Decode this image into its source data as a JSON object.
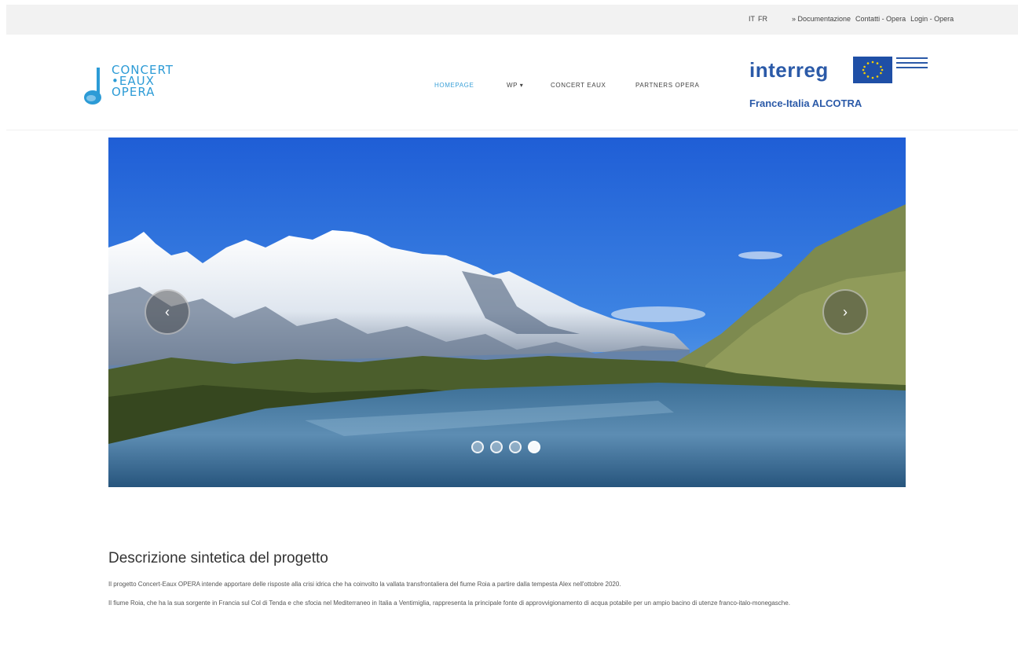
{
  "topbar": {
    "lang_it": "IT",
    "lang_fr": "FR",
    "links": [
      "» Documentazione",
      "Contatti - Opera",
      "Login - Opera"
    ]
  },
  "logo": {
    "line1": "CONCERT",
    "line2": "EAUX",
    "line3": "OPERA"
  },
  "nav": {
    "items": [
      "HOMEPAGE",
      "WP ▾",
      "CONCERT EAUX",
      "PARTNERS OPERA"
    ]
  },
  "interreg": {
    "word": "interreg",
    "sub": "France-Italia ALCOTRA"
  },
  "slider": {
    "prev_label": "‹",
    "next_label": "›",
    "slide_count": 4,
    "active_slide": 4
  },
  "content": {
    "heading": "Descrizione sintetica del progetto",
    "paragraphs": [
      "Il progetto Concert-Eaux OPERA intende apportare delle risposte alla crisi idrica che ha coinvolto la vallata transfrontaliera del fiume Roia a partire dalla tempesta Alex nell'ottobre 2020.",
      "Il fiume Roia, che ha la sua sorgente in Francia sul Col di Tenda e che sfocia nel Mediterraneo in Italia a Ventimiglia, rappresenta la principale fonte di approvvigionamento di acqua potabile per un ampio bacino di utenze franco-italo-monegasche."
    ]
  },
  "colors": {
    "accent": "#3aa0d8",
    "interreg_blue": "#2b5aa8",
    "topbar_bg": "#f2f2f2"
  }
}
